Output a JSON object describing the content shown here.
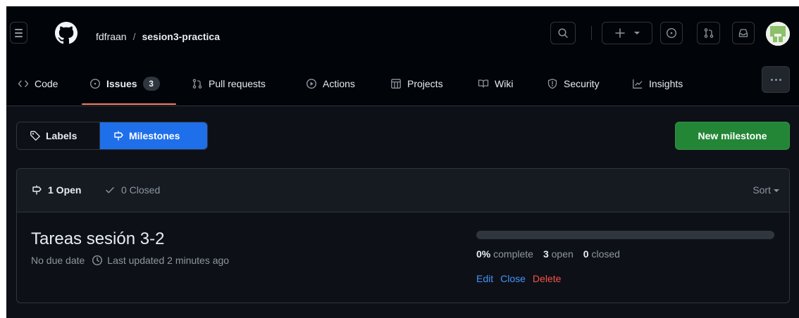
{
  "header": {
    "repo_owner": "fdfraan",
    "repo_separator": "/",
    "repo_name": "sesion3-practica"
  },
  "tabs": [
    {
      "label": "Code",
      "icon": "code-icon"
    },
    {
      "label": "Issues",
      "icon": "issue-opened-icon",
      "counter": "3",
      "active": true
    },
    {
      "label": "Pull requests",
      "icon": "git-pull-request-icon"
    },
    {
      "label": "Actions",
      "icon": "play-icon"
    },
    {
      "label": "Projects",
      "icon": "table-icon"
    },
    {
      "label": "Wiki",
      "icon": "book-icon"
    },
    {
      "label": "Security",
      "icon": "shield-icon"
    },
    {
      "label": "Insights",
      "icon": "graph-icon"
    }
  ],
  "subnav": {
    "labels": "Labels",
    "milestones": "Milestones"
  },
  "new_milestone_label": "New milestone",
  "states": {
    "open": "1 Open",
    "closed": "0 Closed",
    "sort": "Sort"
  },
  "milestone": {
    "title": "Tareas sesión 3-2",
    "due": "No due date",
    "updated": "Last updated 2 minutes ago",
    "progress_fraction": 0,
    "complete": "0%",
    "complete_label": "complete",
    "open_count": "3",
    "open_label": "open",
    "closed_count": "0",
    "closed_label": "closed",
    "actions": {
      "edit": "Edit",
      "close": "Close",
      "delete": "Delete"
    }
  },
  "colors": {
    "background": "#0d1117",
    "header": "#010409",
    "accent_blue": "#1f6feb",
    "success_green": "#238636",
    "danger": "#f85149",
    "tab_underline": "#f78166"
  }
}
